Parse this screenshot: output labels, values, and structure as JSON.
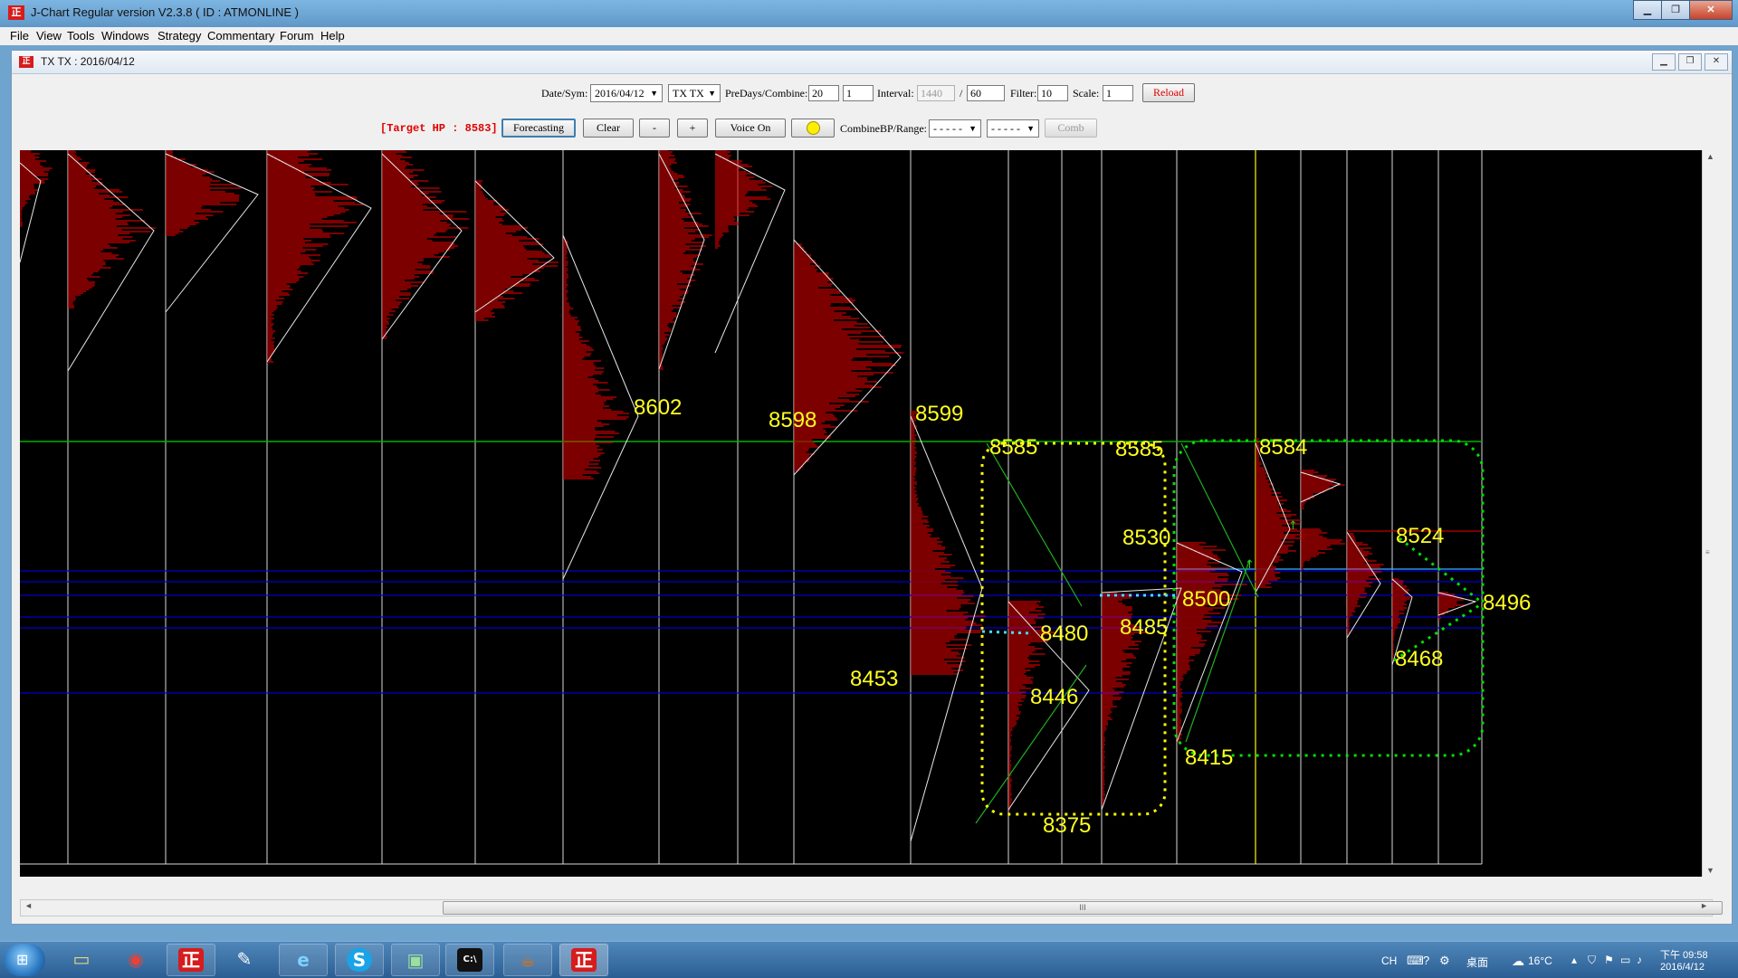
{
  "window": {
    "title": "J-Chart  Regular version V2.3.8    ( ID : ATMONLINE )",
    "logo": "正"
  },
  "menu": [
    "File",
    "View",
    "Tools",
    "Windows",
    "Strategy",
    "Commentary",
    "Forum",
    "Help"
  ],
  "child": {
    "title": "TX TX : 2016/04/12",
    "logo": "正"
  },
  "toolbar1": {
    "date_label": "Date/Sym:",
    "date": "2016/04/12",
    "sym": "TX TX",
    "predays_label": "PreDays/Combine:",
    "predays": "20",
    "combine": "1",
    "interval_label": "Interval:",
    "interval": "1440",
    "slash": "/",
    "interval2": "60",
    "filter_label": "Filter:",
    "filter": "10",
    "scale_label": "Scale:",
    "scale": "1",
    "reload": "Reload"
  },
  "toolbar2": {
    "target": "[Target HP : 8583]",
    "forecasting": "Forecasting",
    "clear": "Clear",
    "minus": "-",
    "plus": "+",
    "voice": "Voice On",
    "combine_label": "CombineBP/Range:",
    "range1": "- - - - -",
    "range2": "- - - - -",
    "comb": "Comb"
  },
  "chart_data": {
    "type": "market-profile",
    "labels": [
      "8602",
      "8598",
      "8599",
      "8585",
      "8585",
      "8584",
      "8530",
      "8524",
      "8500",
      "8496",
      "8480",
      "8485",
      "8453",
      "8446",
      "8468",
      "8415",
      "8375"
    ],
    "colors": {
      "background": "#000000",
      "profile": "#c80000",
      "label": "#ffff20",
      "green_line": "#00b000",
      "blue_line": "#0000c8",
      "dotted_yellow": "#ffff00",
      "dotted_green": "#00e000",
      "dotted_cyan": "#40e0ff"
    }
  },
  "scrollbar": {
    "grip": "III"
  },
  "taskbar": {
    "apps": [
      "folder",
      "chrome",
      "jchart",
      "notes",
      "edge",
      "skype",
      "monitor",
      "cmd",
      "java",
      "jchart2"
    ],
    "icons": {
      "jchart": "正",
      "skype": "S",
      "cmd": "C:\\",
      "java": "☕",
      "chrome": "◉",
      "folder": "▭",
      "notes": "✎",
      "edge": "e",
      "monitor": "▣"
    },
    "tray_lang": "CH",
    "tray_desktop": "桌面",
    "weather": "16°C",
    "time": "下午 09:58",
    "date": "2016/4/12"
  }
}
